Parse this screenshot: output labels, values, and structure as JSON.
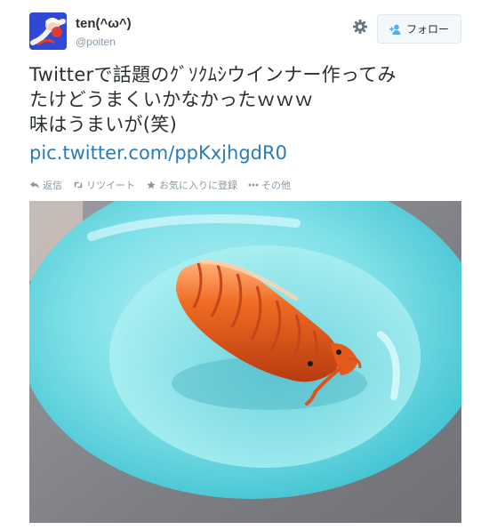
{
  "user": {
    "display_name": "ten(^ω^)",
    "handle": "@poiten"
  },
  "header": {
    "settings_icon": "gear-icon",
    "follow_label": "フォロー",
    "follow_icon": "person-add-icon"
  },
  "tweet": {
    "text_lines": [
      "Twitterで話題のｸﾞｿｸﾑｼウインナー作ってみ",
      "たけどうまくいかなかったｗｗｗ",
      "味はうまいが(笑)"
    ],
    "link": "pic.twitter.com/ppKxjhgdR0"
  },
  "actions": [
    {
      "icon": "reply-icon",
      "label": "返信"
    },
    {
      "icon": "retweet-icon",
      "label": "リツイート"
    },
    {
      "icon": "star-icon",
      "label": "お気に入りに登録"
    },
    {
      "icon": "more-icon",
      "label": "その他"
    }
  ],
  "colors": {
    "link": "#2b7bb9",
    "muted": "#8899a6",
    "bowl": "#5fd1dd",
    "sausage": "#e2521a"
  }
}
